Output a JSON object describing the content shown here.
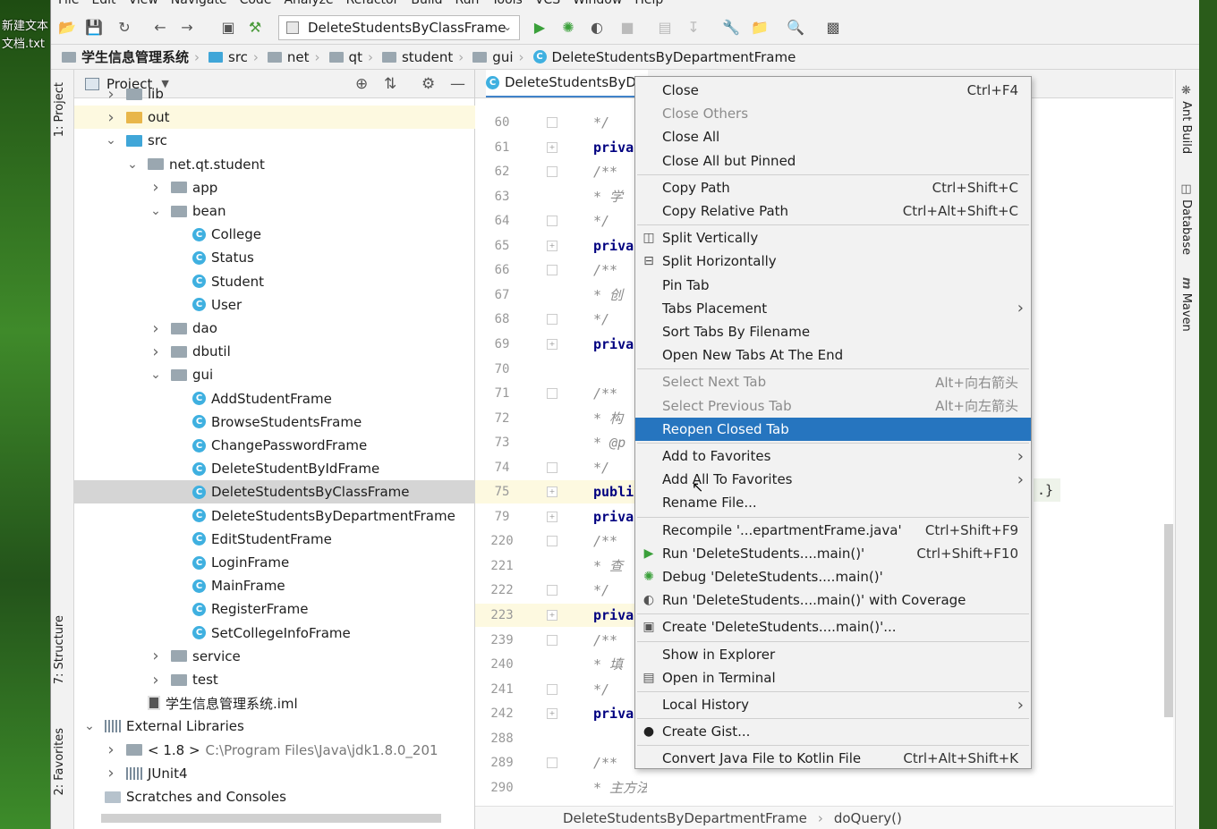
{
  "desktop": {
    "label": "新建文本文档.txt"
  },
  "menubar": [
    "File",
    "Edit",
    "View",
    "Navigate",
    "Code",
    "Analyze",
    "Refactor",
    "Build",
    "Run",
    "Tools",
    "VCS",
    "Window",
    "Help"
  ],
  "toolbar": {
    "run_config": "DeleteStudentsByClassFrame"
  },
  "breadcrumbs": [
    "学生信息管理系统",
    "src",
    "net",
    "qt",
    "student",
    "gui",
    "DeleteStudentsByDepartmentFrame"
  ],
  "left_tabs": {
    "project": "1: Project",
    "structure": "7: Structure",
    "favorites": "2: Favorites"
  },
  "right_tabs": {
    "ant": "Ant Build",
    "database": "Database",
    "maven": "Maven"
  },
  "project_panel": {
    "title": "Project"
  },
  "tree": [
    {
      "label": "lib",
      "depth": 1,
      "kind": "folder",
      "arrow": "right"
    },
    {
      "label": "out",
      "depth": 1,
      "kind": "folder-orange",
      "arrow": "right"
    },
    {
      "label": "src",
      "depth": 1,
      "kind": "folder-blue",
      "arrow": "down"
    },
    {
      "label": "net.qt.student",
      "depth": 2,
      "kind": "folder",
      "arrow": "down"
    },
    {
      "label": "app",
      "depth": 3,
      "kind": "folder",
      "arrow": "right"
    },
    {
      "label": "bean",
      "depth": 3,
      "kind": "folder",
      "arrow": "down"
    },
    {
      "label": "College",
      "depth": 4,
      "kind": "class"
    },
    {
      "label": "Status",
      "depth": 4,
      "kind": "class"
    },
    {
      "label": "Student",
      "depth": 4,
      "kind": "class"
    },
    {
      "label": "User",
      "depth": 4,
      "kind": "class"
    },
    {
      "label": "dao",
      "depth": 3,
      "kind": "folder",
      "arrow": "right"
    },
    {
      "label": "dbutil",
      "depth": 3,
      "kind": "folder",
      "arrow": "right"
    },
    {
      "label": "gui",
      "depth": 3,
      "kind": "folder",
      "arrow": "down"
    },
    {
      "label": "AddStudentFrame",
      "depth": 4,
      "kind": "class"
    },
    {
      "label": "BrowseStudentsFrame",
      "depth": 4,
      "kind": "class"
    },
    {
      "label": "ChangePasswordFrame",
      "depth": 4,
      "kind": "class"
    },
    {
      "label": "DeleteStudentByIdFrame",
      "depth": 4,
      "kind": "class"
    },
    {
      "label": "DeleteStudentsByClassFrame",
      "depth": 4,
      "kind": "class",
      "selected": true
    },
    {
      "label": "DeleteStudentsByDepartmentFrame",
      "depth": 4,
      "kind": "class"
    },
    {
      "label": "EditStudentFrame",
      "depth": 4,
      "kind": "class"
    },
    {
      "label": "LoginFrame",
      "depth": 4,
      "kind": "class"
    },
    {
      "label": "MainFrame",
      "depth": 4,
      "kind": "class"
    },
    {
      "label": "RegisterFrame",
      "depth": 4,
      "kind": "class"
    },
    {
      "label": "SetCollegeInfoFrame",
      "depth": 4,
      "kind": "class"
    },
    {
      "label": "service",
      "depth": 3,
      "kind": "folder",
      "arrow": "right"
    },
    {
      "label": "test",
      "depth": 3,
      "kind": "folder",
      "arrow": "right"
    },
    {
      "label": "学生信息管理系统.iml",
      "depth": 2,
      "kind": "iml"
    },
    {
      "label": "External Libraries",
      "depth": 0,
      "kind": "lib",
      "arrow": "down"
    },
    {
      "label": "< 1.8 >",
      "depth": 1,
      "kind": "folder",
      "arrow": "right",
      "extra": "C:\\Program Files\\Java\\jdk1.8.0_201"
    },
    {
      "label": "JUnit4",
      "depth": 1,
      "kind": "lib",
      "arrow": "right"
    },
    {
      "label": "Scratches and Consoles",
      "depth": 0,
      "kind": "scratch"
    }
  ],
  "editor": {
    "tab": "DeleteStudentsByDe",
    "lines": [
      {
        "n": "60",
        "code": "*/",
        "type": "cm"
      },
      {
        "n": "61",
        "code": "priva",
        "type": "kw"
      },
      {
        "n": "62",
        "code": "/**",
        "type": "cm"
      },
      {
        "n": "63",
        "code": "* 学",
        "type": "cm"
      },
      {
        "n": "64",
        "code": "*/",
        "type": "cm"
      },
      {
        "n": "65",
        "code": "priva",
        "type": "kw"
      },
      {
        "n": "66",
        "code": "/**",
        "type": "cm"
      },
      {
        "n": "67",
        "code": "* 创",
        "type": "cm"
      },
      {
        "n": "68",
        "code": "*/",
        "type": "cm"
      },
      {
        "n": "69",
        "code": "priva",
        "type": "kw"
      },
      {
        "n": "70",
        "code": "",
        "type": "cm"
      },
      {
        "n": "71",
        "code": "/**",
        "type": "cm"
      },
      {
        "n": "72",
        "code": "* 构",
        "type": "cm"
      },
      {
        "n": "73",
        "code": "* @p",
        "type": "cm"
      },
      {
        "n": "74",
        "code": "*/",
        "type": "cm"
      },
      {
        "n": "75",
        "code": "publi",
        "type": "kw",
        "hl": true
      },
      {
        "n": "79",
        "code": "priva",
        "type": "kw"
      },
      {
        "n": "220",
        "code": "/**",
        "type": "cm"
      },
      {
        "n": "221",
        "code": "* 查",
        "type": "cm"
      },
      {
        "n": "222",
        "code": "*/",
        "type": "cm"
      },
      {
        "n": "223",
        "code": "priva",
        "type": "kw",
        "hl": true
      },
      {
        "n": "239",
        "code": "/**",
        "type": "cm"
      },
      {
        "n": "240",
        "code": "* 填",
        "type": "cm"
      },
      {
        "n": "241",
        "code": "*/",
        "type": "cm"
      },
      {
        "n": "242",
        "code": "priva",
        "type": "kw"
      },
      {
        "n": "288",
        "code": "",
        "type": "cm"
      },
      {
        "n": "289",
        "code": "/**",
        "type": "cm"
      },
      {
        "n": "290",
        "code": "* 主方法",
        "type": "cm"
      }
    ],
    "trail": ".}",
    "bottom_crumbs": [
      "DeleteStudentsByDepartmentFrame",
      "doQuery()"
    ]
  },
  "context_menu": [
    {
      "label": "Close",
      "shortcut": "Ctrl+F4"
    },
    {
      "label": "Close Others",
      "disabled": true
    },
    {
      "label": "Close All"
    },
    {
      "label": "Close All but Pinned"
    },
    {
      "sep": true
    },
    {
      "label": "Copy Path",
      "shortcut": "Ctrl+Shift+C"
    },
    {
      "label": "Copy Relative Path",
      "shortcut": "Ctrl+Alt+Shift+C"
    },
    {
      "sep": true
    },
    {
      "label": "Split Vertically",
      "icon": "split-vertical-icon"
    },
    {
      "label": "Split Horizontally",
      "icon": "split-horizontal-icon"
    },
    {
      "label": "Pin Tab"
    },
    {
      "label": "Tabs Placement",
      "submenu": true
    },
    {
      "label": "Sort Tabs By Filename"
    },
    {
      "label": "Open New Tabs At The End"
    },
    {
      "sep": true
    },
    {
      "label": "Select Next Tab",
      "shortcut": "Alt+向右箭头",
      "disabled": true
    },
    {
      "label": "Select Previous Tab",
      "shortcut": "Alt+向左箭头",
      "disabled": true
    },
    {
      "label": "Reopen Closed Tab",
      "active": true
    },
    {
      "sep": true
    },
    {
      "label": "Add to Favorites",
      "submenu": true
    },
    {
      "label": "Add All To Favorites",
      "submenu": true
    },
    {
      "label": "Rename File..."
    },
    {
      "sep": true
    },
    {
      "label": "Recompile '...epartmentFrame.java'",
      "shortcut": "Ctrl+Shift+F9"
    },
    {
      "label": "Run 'DeleteStudents....main()'",
      "shortcut": "Ctrl+Shift+F10",
      "icon": "run-icon"
    },
    {
      "label": "Debug 'DeleteStudents....main()'",
      "icon": "debug-icon"
    },
    {
      "label": "Run 'DeleteStudents....main()' with Coverage",
      "icon": "coverage-icon"
    },
    {
      "sep": true
    },
    {
      "label": "Create 'DeleteStudents....main()'...",
      "icon": "create-config-icon"
    },
    {
      "sep": true
    },
    {
      "label": "Show in Explorer"
    },
    {
      "label": "Open in Terminal",
      "icon": "terminal-icon"
    },
    {
      "sep": true
    },
    {
      "label": "Local History",
      "submenu": true
    },
    {
      "sep": true
    },
    {
      "label": "Create Gist...",
      "icon": "github-icon"
    },
    {
      "sep": true
    },
    {
      "label": "Convert Java File to Kotlin File",
      "shortcut": "Ctrl+Alt+Shift+K"
    }
  ]
}
